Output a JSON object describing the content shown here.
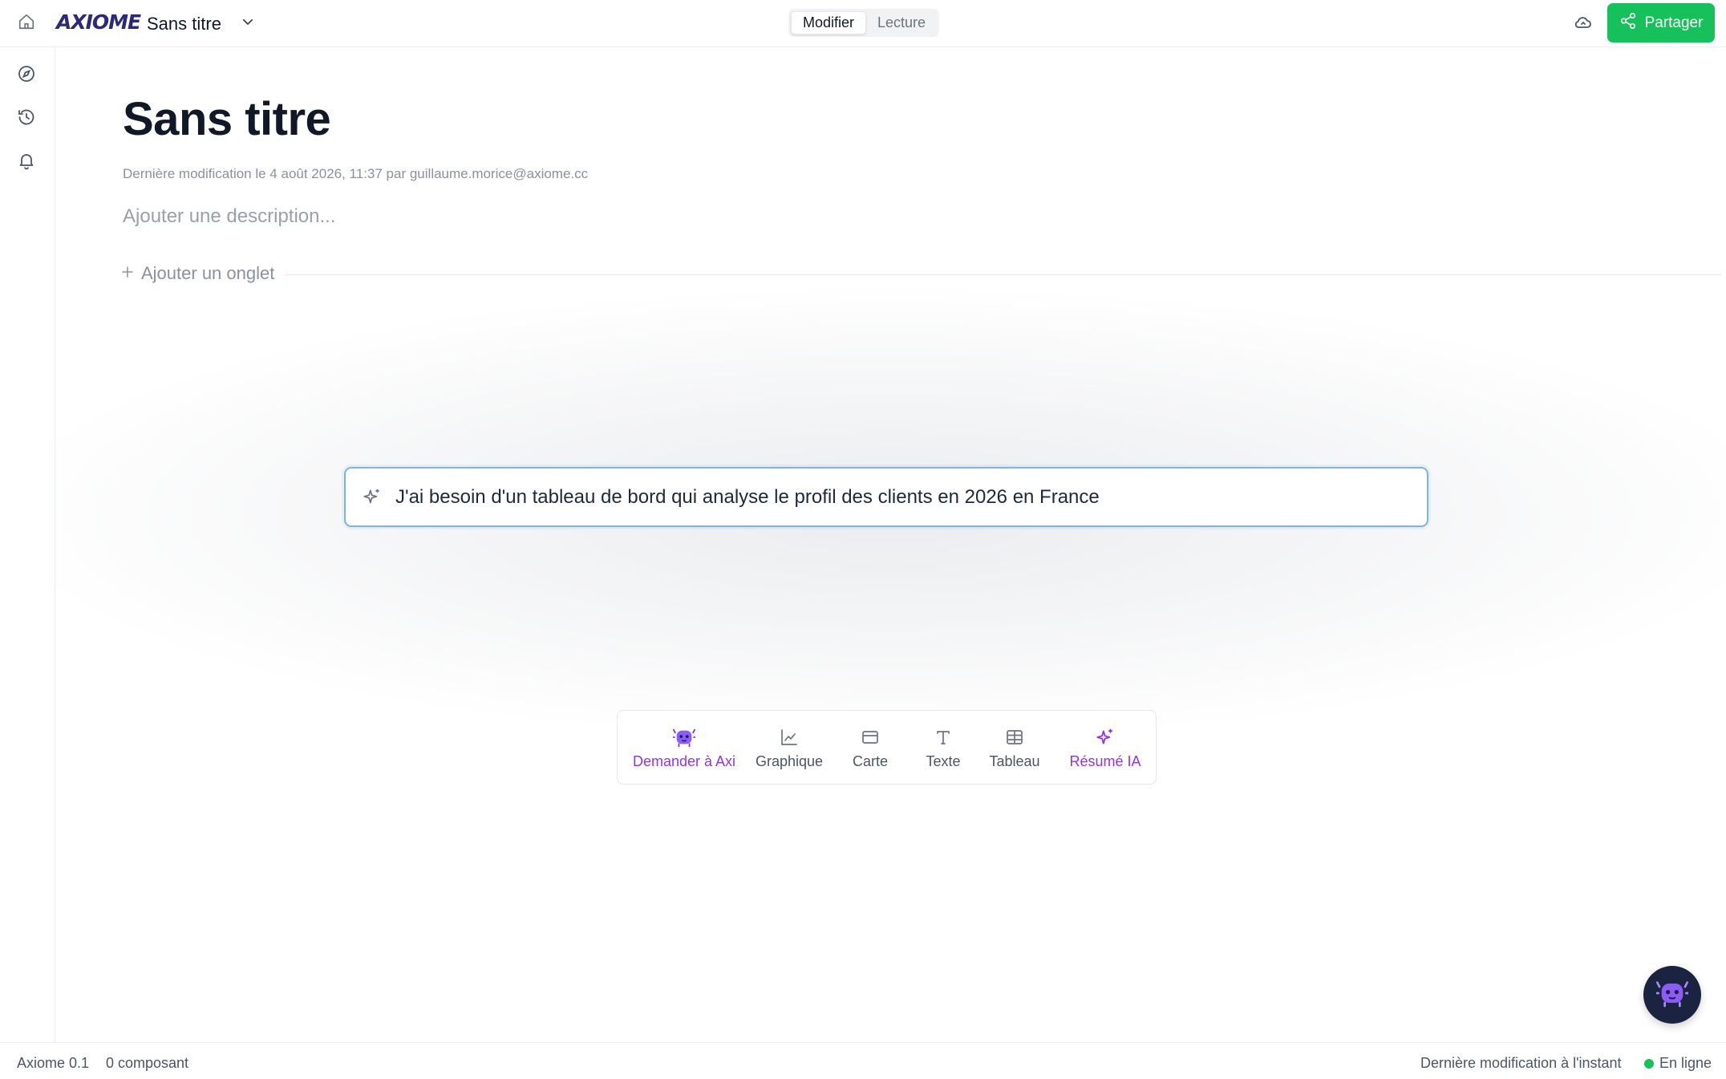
{
  "app": {
    "logo": "AXIOME",
    "doc_title": "Sans titre"
  },
  "topbar": {
    "mode_edit": "Modifier",
    "mode_read": "Lecture",
    "active_mode": "Modifier",
    "share_label": "Partager"
  },
  "leftrail": {
    "items": [
      {
        "icon": "compass-icon",
        "name": "explore"
      },
      {
        "icon": "history-icon",
        "name": "history"
      },
      {
        "icon": "bell-icon",
        "name": "notifications"
      }
    ]
  },
  "page": {
    "title": "Sans titre",
    "meta": "Dernière modification le 4 août 2026, 11:37 par guillaume.morice@axiome.cc",
    "description_placeholder": "Ajouter une description...",
    "add_tab_label": "Ajouter un onglet"
  },
  "prompt": {
    "value": "J'ai besoin d'un tableau de bord qui analyse le profil des clients en 2026 en France"
  },
  "toolbar": {
    "items": [
      {
        "label": "Demander à Axi",
        "icon": "axi-mascot-icon",
        "accent": "#9333ea"
      },
      {
        "label": "Graphique",
        "icon": "line-chart-icon"
      },
      {
        "label": "Carte",
        "icon": "card-icon"
      },
      {
        "label": "Texte",
        "icon": "text-icon"
      },
      {
        "label": "Tableau",
        "icon": "table-icon"
      },
      {
        "label": "Résumé IA",
        "icon": "sparkles-icon",
        "accent": "#9333ea"
      }
    ]
  },
  "statusbar": {
    "version": "Axiome 0.1",
    "components": "0 composant",
    "last_saved": "Dernière modification à l'instant",
    "connection": "En ligne"
  },
  "colors": {
    "brand": "#2b2a7a",
    "share_green": "#16c05a",
    "ai_purple": "#9333ea",
    "prompt_border": "#7cb4ea",
    "fab_bg": "#1a2340"
  }
}
